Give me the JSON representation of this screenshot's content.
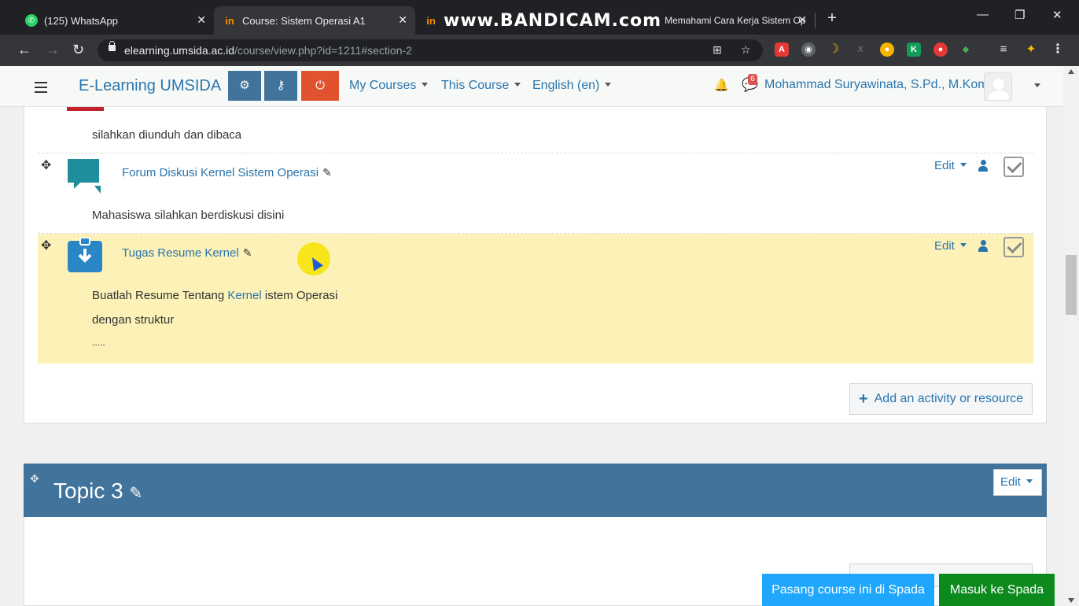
{
  "browser": {
    "tabs": [
      {
        "title": "(125) WhatsApp",
        "icon": "whatsapp-icon"
      },
      {
        "title": "Course: Sistem Operasi A1",
        "icon": "moodle-icon"
      },
      {
        "title": "Memahami Cara Kerja Sistem Op",
        "icon": "moodle-icon"
      }
    ],
    "watermark": "www.BANDICAM.com",
    "url_host": "elearning.umsida.ac.id",
    "url_path": "/course/view.php?id=1211#section-2",
    "colors": {
      "chrome_dark": "#202124",
      "chrome_mid": "#35363a"
    }
  },
  "navbar": {
    "brand": "E-Learning UMSIDA",
    "menus": [
      "My Courses",
      "This Course",
      "English (en)"
    ],
    "messages_count": "6",
    "user_name": "Mohammad Suryawinata, S.Pd., M.Kom",
    "colors": {
      "tool_blue": "#41739b",
      "power_red": "#e0532e"
    }
  },
  "section": {
    "top_description": "silahkan diunduh dan dibaca",
    "activities": [
      {
        "title": "Forum Diskusi Kernel Sistem Operasi",
        "icon": "forum-icon",
        "edit_label": "Edit",
        "description": "Mahasiswa silahkan berdiskusi disini"
      },
      {
        "title": "Tugas Resume Kernel",
        "icon": "assignment-icon",
        "edit_label": "Edit",
        "desc_prefix": "Buatlah Resume Tentang ",
        "desc_link": "Kernel",
        "desc_suffix": " istem Operasi",
        "desc_line2": "dengan struktur",
        "desc_line3": "....."
      }
    ],
    "add_activity_label": "Add an activity or resource"
  },
  "topic3": {
    "title": "Topic 3",
    "edit_label": "Edit"
  },
  "footer_buttons": {
    "pasang_label": "Pasang course ini di Spada",
    "masuk_label": "Masuk ke Spada",
    "colors": {
      "pasang": "#1ea7fd",
      "masuk": "#0c8a1e"
    }
  }
}
